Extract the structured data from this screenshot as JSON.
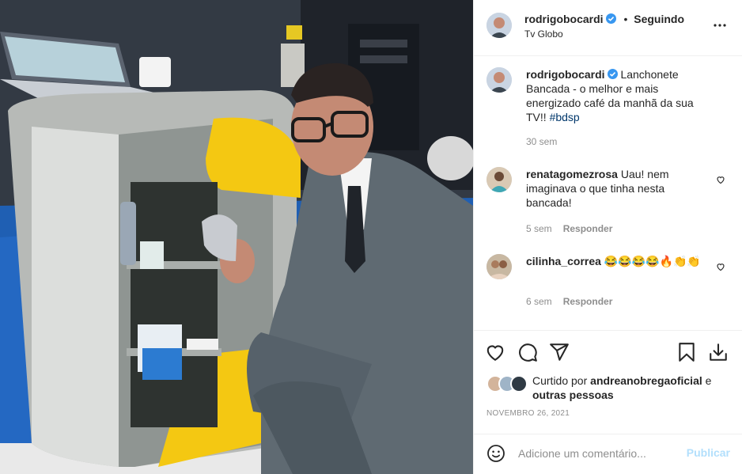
{
  "post": {
    "image_alt": "Man in grey suit kneeling beside a studio counter holding a foil-wrapped sandwich",
    "author": {
      "username": "rodrigobocardi",
      "verified": true,
      "separator": "•",
      "follow_status": "Seguindo",
      "location": "Tv Globo"
    },
    "caption": {
      "username": "rodrigobocardi",
      "text": "Lanchonete Bancada - o melhor e mais energizado café da manhã da sua TV!!",
      "hashtag": "#bdsp",
      "time": "30 sem"
    },
    "comments": [
      {
        "username": "renatagomezrosa",
        "text": "Uau! nem imaginava o que tinha nesta bancada!",
        "time": "5 sem",
        "reply_label": "Responder"
      },
      {
        "username": "cilinha_correa",
        "text": "😂😂😂😂🔥👏👏",
        "time": "6 sem",
        "reply_label": "Responder"
      }
    ],
    "likes": {
      "prefix": "Curtido por",
      "user": "andreanobregaoficial",
      "conjunction": "e",
      "others": "outras pessoas"
    },
    "date": "NOVEMBRO 26, 2021",
    "add_comment": {
      "placeholder": "Adicione um comentário...",
      "publish_label": "Publicar"
    }
  },
  "colors": {
    "accent_disabled": "#b2dffc",
    "verified": "#3897f0",
    "muted": "#8e8e8e",
    "link": "#00376b"
  },
  "icons": [
    "more-icon",
    "verified-icon",
    "heart-icon",
    "comment-icon",
    "share-icon",
    "bookmark-icon",
    "download-icon",
    "emoji-icon"
  ]
}
